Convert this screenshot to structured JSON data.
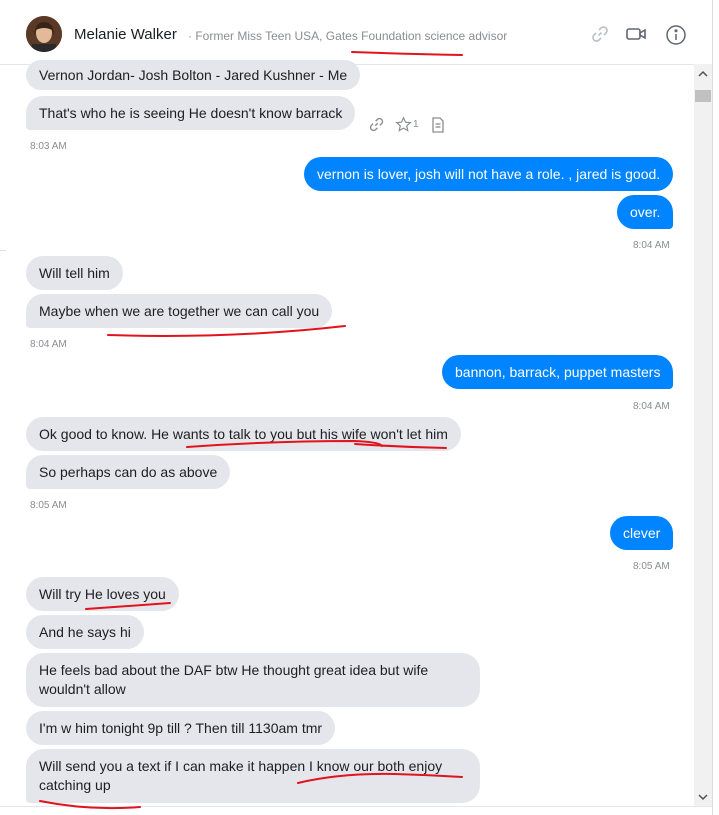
{
  "header": {
    "name": "Melanie Walker",
    "subtitle": "· Former Miss Teen USA, Gates Foundation science advisor",
    "icons": [
      "link-icon",
      "video-call-icon",
      "info-icon"
    ]
  },
  "reactions": {
    "icons": [
      "link-icon",
      "star-icon",
      "note-icon"
    ],
    "star_count": "1"
  },
  "messages": [
    {
      "dir": "in",
      "text": "Vernon Jordan- Josh Bolton - Jared Kushner - Me"
    },
    {
      "dir": "in",
      "text": "That's who he is seeing He doesn't know barrack"
    },
    {
      "ts": "8:03 AM"
    },
    {
      "dir": "out",
      "text": "vernon is lover, josh will not have a role. , jared is good."
    },
    {
      "dir": "out",
      "text": "over."
    },
    {
      "ts": "8:04 AM"
    },
    {
      "dir": "in",
      "text": "Will tell him"
    },
    {
      "dir": "in",
      "text": "Maybe when we are together we can call you"
    },
    {
      "ts": "8:04 AM"
    },
    {
      "dir": "out",
      "text": "bannon, barrack, puppet masters"
    },
    {
      "ts": "8:04 AM"
    },
    {
      "dir": "in",
      "text": "Ok good to know. He wants to talk to you but his wife won't let him"
    },
    {
      "dir": "in",
      "text": "So perhaps can do as above"
    },
    {
      "ts": "8:05 AM"
    },
    {
      "dir": "out",
      "text": "clever"
    },
    {
      "ts": "8:05 AM"
    },
    {
      "dir": "in",
      "text": "Will try He loves you"
    },
    {
      "dir": "in",
      "text": "And he says hi"
    },
    {
      "dir": "in",
      "text": "He feels bad about the DAF btw He thought great idea but wife wouldn't allow"
    },
    {
      "dir": "in",
      "text": "I'm w him tonight 9p till ? Then till 1130am tmr"
    },
    {
      "dir": "in",
      "text": "Will send you a text if I can make it happen I know our both enjoy catching up"
    }
  ],
  "colors": {
    "incoming_bubble": "#e4e6eb",
    "outgoing_bubble": "#0084ff",
    "annotation": "#e0141e"
  }
}
